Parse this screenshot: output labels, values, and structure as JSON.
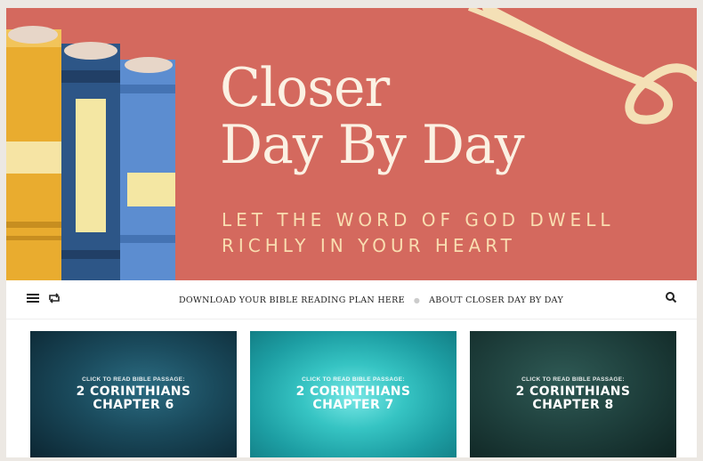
{
  "hero": {
    "title_line1": "Closer",
    "title_line2": "Day By Day",
    "tagline_line1": "LET THE WORD OF GOD DWELL",
    "tagline_line2": "RICHLY IN YOUR HEART",
    "background_color": "#d4695e"
  },
  "nav": {
    "menu_icon": "hamburger-menu-icon",
    "shuffle_icon": "shuffle-icon",
    "search_icon": "search-icon",
    "links": [
      {
        "label": "DOWNLOAD YOUR BIBLE READING PLAN HERE"
      },
      {
        "label": "ABOUT CLOSER DAY BY DAY"
      }
    ],
    "separator": "●"
  },
  "cards": [
    {
      "small": "CLICK TO READ BIBLE PASSAGE:",
      "line1": "2 CORINTHIANS",
      "line2": "CHAPTER 6",
      "color": "#1a4a5c"
    },
    {
      "small": "CLICK TO READ BIBLE PASSAGE:",
      "line1": "2 CORINTHIANS",
      "line2": "CHAPTER 7",
      "color": "#36c4c3"
    },
    {
      "small": "CLICK TO READ BIBLE PASSAGE:",
      "line1": "2 CORINTHIANS",
      "line2": "CHAPTER 8",
      "color": "#1e3f3c"
    }
  ]
}
